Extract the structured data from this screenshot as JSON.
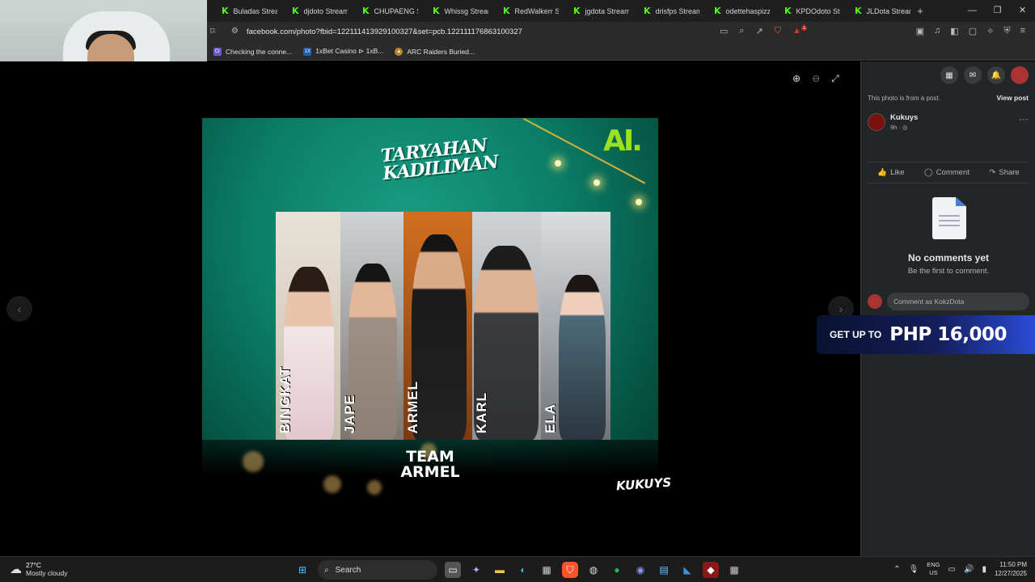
{
  "browser": {
    "tabs": [
      {
        "label": "Buladas Stream"
      },
      {
        "label": "djdoto Stream"
      },
      {
        "label": "CHUPAENG Str"
      },
      {
        "label": "Whissg Stream"
      },
      {
        "label": "RedWalkerr Str"
      },
      {
        "label": "jgdota Stream"
      },
      {
        "label": "drisfps Stream"
      },
      {
        "label": "odettehaspizza"
      },
      {
        "label": "KPDOdoto Stre"
      },
      {
        "label": "JLDota Stream"
      }
    ],
    "url": "facebook.com/photo?fbid=122111413929100327&set=pcb.122111176863100327",
    "bookmarks": [
      {
        "label": "Checking the conne..."
      },
      {
        "label": "1xBet Casino ⊳ 1xB..."
      },
      {
        "label": "ARC Raiders Buried..."
      }
    ],
    "shield_badge": "1"
  },
  "poster": {
    "title_line1": "TARYAHAN",
    "title_line2": "KADILIMAN",
    "brand_logo": "AI.",
    "names": [
      "BINGKAT",
      "JAPE",
      "ARMEL",
      "KARL",
      "ELA"
    ],
    "team_line1": "TEAM",
    "team_line2": "ARMEL",
    "sponsor_logo": "KUKUYS"
  },
  "panel": {
    "from_post": "This photo is from a post.",
    "view_post": "View post",
    "author_name": "Kukuys",
    "author_time": "9h · ",
    "like": "Like",
    "comment": "Comment",
    "share": "Share",
    "no_comments_title": "No comments yet",
    "no_comments_sub": "Be the first to comment.",
    "comment_placeholder": "Comment as KokzDota"
  },
  "promo": {
    "prefix": "GET UP TO",
    "amount": "PHP 16,000"
  },
  "taskbar": {
    "temperature": "27°C",
    "condition": "Mostly cloudy",
    "search_label": "Search",
    "lang_line1": "ENG",
    "lang_line2": "US",
    "time": "11:50 PM",
    "date": "12/27/2025"
  },
  "colors": {
    "kick_green": "#53fc18",
    "fb_panel": "#242526",
    "poster_teal": "#0b7d67"
  }
}
